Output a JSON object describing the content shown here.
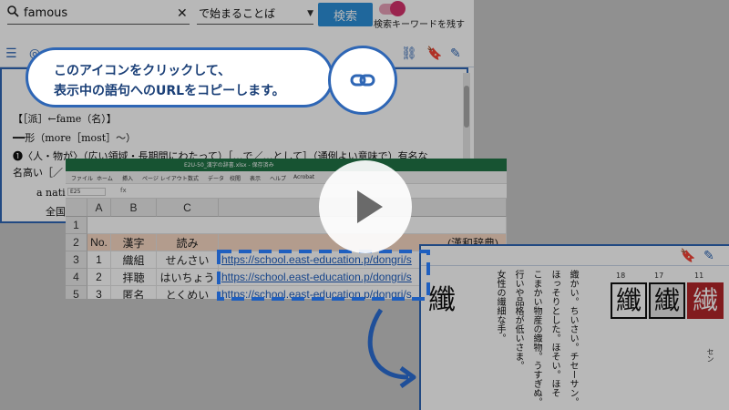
{
  "dictionary": {
    "search_value": "famous",
    "mode_select": "で始まることば",
    "search_button": "検索",
    "keep_keyword_label": "検索キーワードを残す",
    "entry_lines": [
      "【［派］←fame（名）】",
      "━━形（more［most］～）",
      "❶〈人・物が〉（広い領域・長期間にわたって）［…で／…として］（通例よい意味で）有名な",
      "名高い［／",
      "a natio",
      "全国"
    ]
  },
  "tooltip": {
    "line1": "このアイコンをクリックして、",
    "line2": "表示中の語句へのURLをコピーします。"
  },
  "excel": {
    "title": "E2U-50_漢字の辞書.xlsx - 保存済み",
    "ribbon": [
      "ファイル",
      "ホーム",
      "挿入",
      "ページ レイアウト",
      "数式",
      "データ",
      "校閲",
      "表示",
      "ヘルプ",
      "Acrobat"
    ],
    "name_box": "E25",
    "fx": "fx",
    "columns": [
      "A",
      "B",
      "C"
    ],
    "rows": [
      {
        "num": "1",
        "a": "",
        "b": "",
        "c": "",
        "d": ""
      },
      {
        "num": "2",
        "a": "No.",
        "b": "漢字",
        "c": "読み",
        "d": "(漢和辞典)"
      },
      {
        "num": "3",
        "a": "1",
        "b": "織組",
        "c": "せんさい",
        "d": "https://school.east-education.p/dongri/s"
      },
      {
        "num": "4",
        "a": "2",
        "b": "拝聴",
        "c": "はいちょう",
        "d": "https://school.east-education.p/dongri/s"
      },
      {
        "num": "5",
        "a": "3",
        "b": "匿名",
        "c": "とくめい",
        "d": "https://school.east-education.p/dongri/s"
      }
    ]
  },
  "kanji_page": {
    "main_char": "纖",
    "columns": [
      "織かい。ちいさい。チセーサン。",
      "ほっそりとした。ほそい。ほそ",
      "こまかい物産の織物。うすぎぬ。",
      "行いや品格が低いさま。",
      "女性の繊細な手。"
    ],
    "glyphs": [
      {
        "char": "纖",
        "style": "boxed",
        "num": "18"
      },
      {
        "char": "纎",
        "style": "boxed-grey",
        "num": "17"
      },
      {
        "char": "繊",
        "style": "red",
        "num": "11"
      }
    ],
    "reading": "セン"
  },
  "colors": {
    "accent": "#2e66b5",
    "excel_green": "#217346",
    "search_button": "#2b8fd8",
    "toggle": "#d6336c",
    "link_text": "#1f5fbf"
  },
  "icons": [
    "search-icon",
    "close-icon",
    "chevron-down-icon",
    "link-icon",
    "bookmark-icon",
    "note-icon",
    "play-icon",
    "arrow-icon"
  ]
}
